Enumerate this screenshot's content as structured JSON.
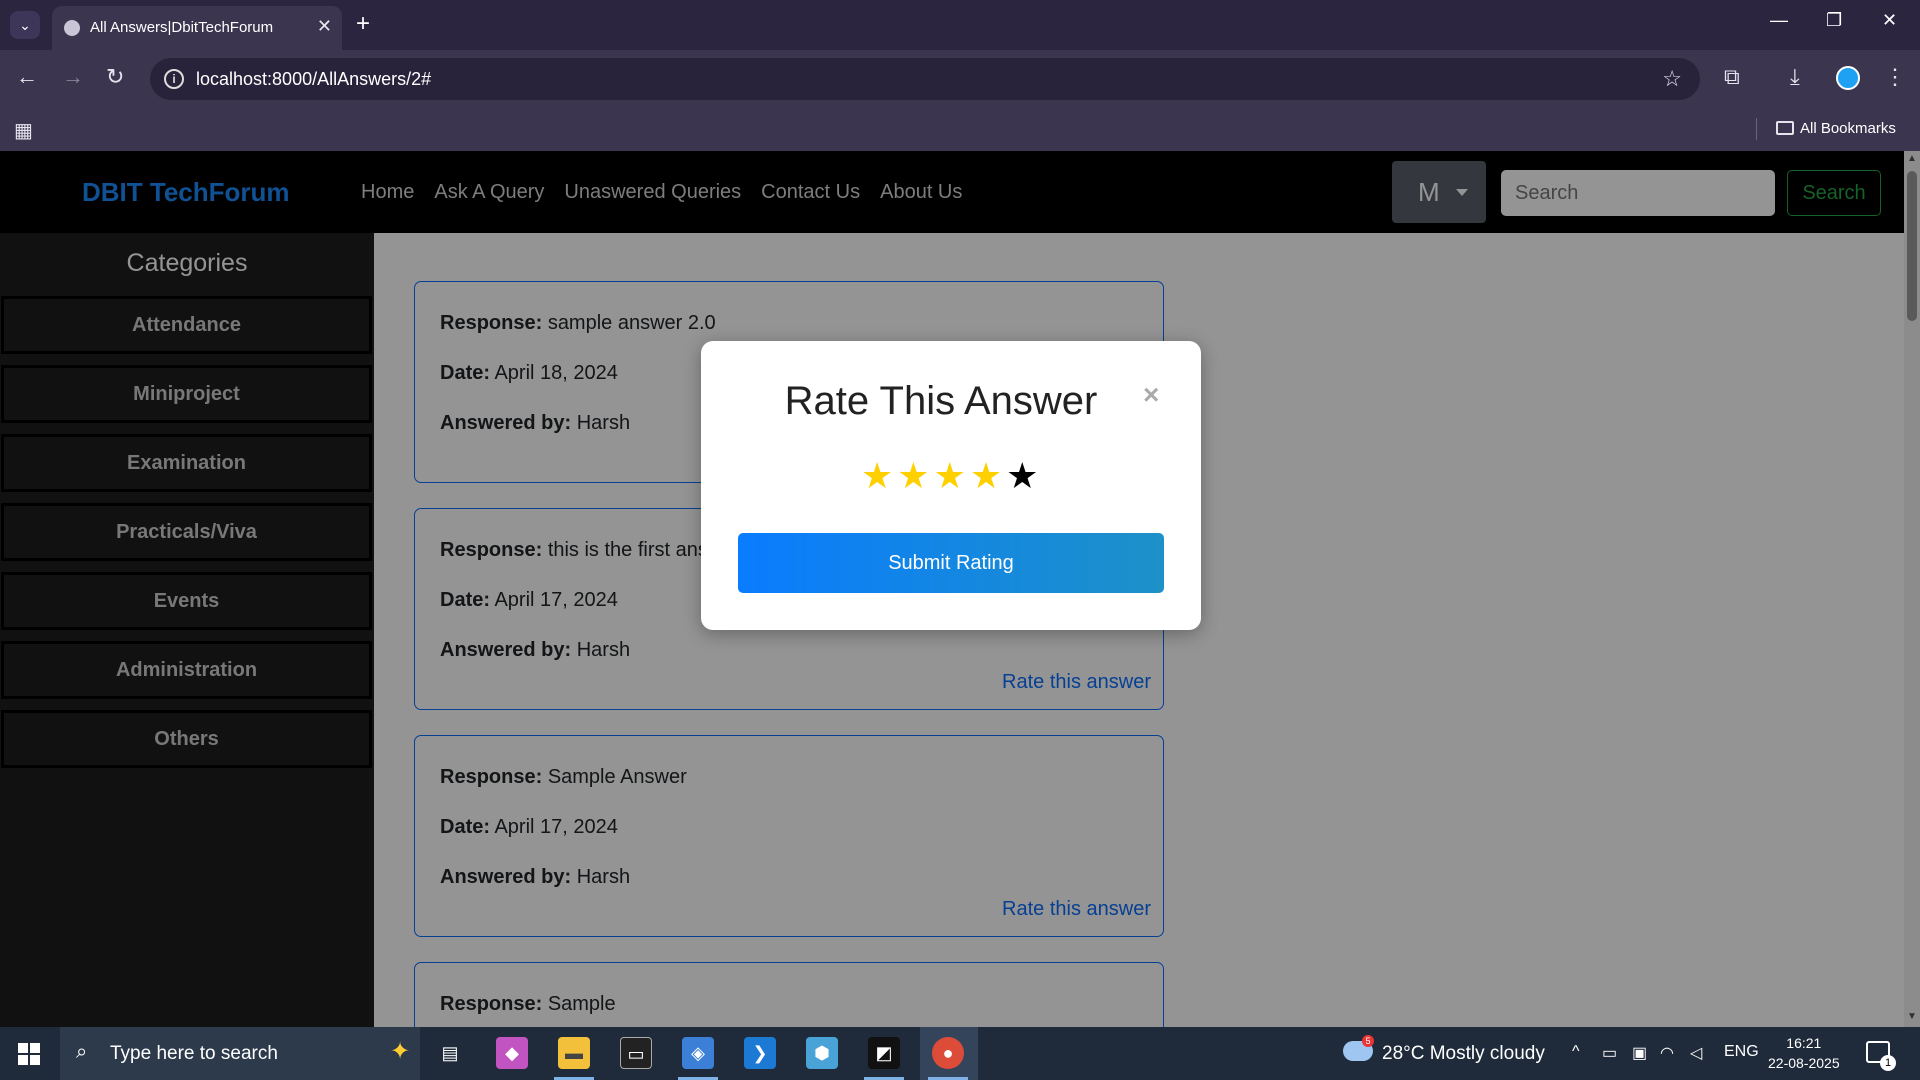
{
  "browser": {
    "tab_title": "All Answers|DbitTechForum",
    "url": "localhost:8000/AllAnswers/2#",
    "bookmarks_label": "All Bookmarks"
  },
  "site": {
    "brand": "DBIT TechForum",
    "nav": [
      "Home",
      "Ask A Query",
      "Unaswered Queries",
      "Contact Us",
      "About Us"
    ],
    "user_initial": "M",
    "search_placeholder": "Search",
    "search_button": "Search"
  },
  "sidebar": {
    "title": "Categories",
    "items": [
      "Attendance",
      "Miniproject",
      "Examination",
      "Practicals/Viva",
      "Events",
      "Administration",
      "Others"
    ]
  },
  "labels": {
    "response": "Response:",
    "date": "Date:",
    "answered_by": "Answered by:",
    "rate_link": "Rate this answer"
  },
  "answers": [
    {
      "response": "sample answer 2.0",
      "date": "April 18, 2024",
      "answered_by": "Harsh"
    },
    {
      "response": "this is the first ans",
      "date": "April 17, 2024",
      "answered_by": "Harsh"
    },
    {
      "response": "Sample Answer",
      "date": "April 17, 2024",
      "answered_by": "Harsh"
    },
    {
      "response": "Sample"
    }
  ],
  "modal": {
    "title": "Rate This Answer",
    "close": "×",
    "rating": 4,
    "max_rating": 5,
    "submit_label": "Submit Rating"
  },
  "taskbar": {
    "search_placeholder": "Type here to search",
    "weather_badge": "5",
    "weather": "28°C  Mostly cloudy",
    "language": "ENG",
    "time": "16:21",
    "date": "22-08-2025",
    "notification_count": "1"
  },
  "colors": {
    "brand": "#1c8cff",
    "link": "#0d6efd",
    "star_active": "#ffd000",
    "search_button": "#28a745"
  }
}
